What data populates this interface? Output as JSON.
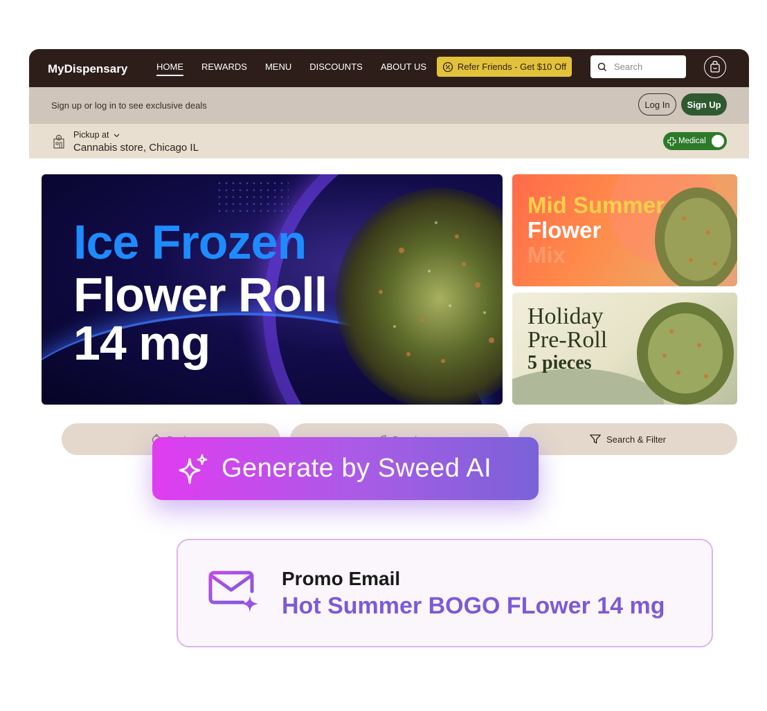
{
  "nav": {
    "brand": "MyDispensary",
    "links": [
      "HOME",
      "REWARDS",
      "MENU",
      "DISCOUNTS",
      "ABOUT US"
    ],
    "active_link": "HOME",
    "refer_label": "Refer Friends - Get $10 Off",
    "search_placeholder": "Search"
  },
  "signup_bar": {
    "text": "Sign up or log in to see exclusive deals",
    "login_label": "Log In",
    "signup_label": "Sign Up"
  },
  "pickup": {
    "label": "Pickup at",
    "store": "Cannabis store, Chicago IL",
    "medical_label": "Medical",
    "medical_on": true
  },
  "banners": {
    "main": {
      "line1": "Ice Frozen",
      "line2": "Flower Roll",
      "line3": "14 mg"
    },
    "side_a": {
      "line1": "Mid Summer",
      "line2": "Flower",
      "line3": "Mix"
    },
    "side_b": {
      "line1": "Holiday",
      "line2": "Pre-Roll",
      "line3": "5 pieces"
    }
  },
  "pills": [
    {
      "label": "Deals",
      "icon": "deals-tag-icon"
    },
    {
      "label": "Brands",
      "icon": "brands-leaf-icon"
    },
    {
      "label": "Search & Filter",
      "icon": "filter-icon"
    }
  ],
  "ai_button": {
    "label": "Generate by Sweed AI",
    "icon": "sparkle-icon"
  },
  "promo": {
    "title": "Promo Email",
    "subject": "Hot Summer BOGO FLower 14 mg",
    "icon": "mail-sparkle-icon"
  },
  "colors": {
    "nav_bg": "#2e1e1a",
    "refer_bg": "#e2c23a",
    "signup_green": "#2f5a2f",
    "medical_green": "#2d7a2a",
    "ai_gradient_start": "#e03cf0",
    "ai_gradient_end": "#7a62d8",
    "promo_subject": "#7d5ad6"
  }
}
